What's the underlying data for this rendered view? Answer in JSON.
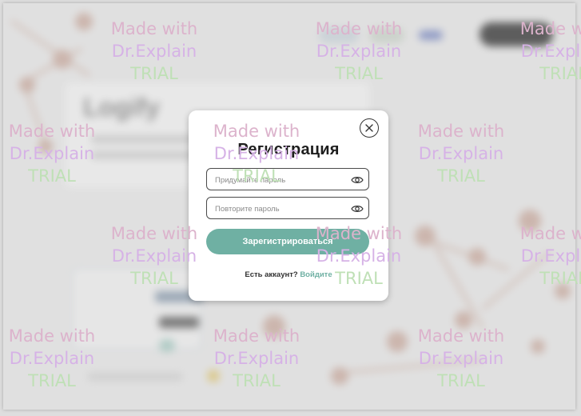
{
  "modal": {
    "title": "Регистрация",
    "password_placeholder": "Придумайте пароль",
    "repeat_password_placeholder": "Повторите пароль",
    "submit_label": "Зарегистрироваться",
    "footer_text": "Есть аккаунт?",
    "login_link": "Войдите",
    "accent_color": "#6fb0a3",
    "close_icon": "close-icon",
    "eye_icon": "eye-icon"
  },
  "background": {
    "logo_text": "Logify"
  },
  "watermark": {
    "line1": "Made with",
    "line2": "Dr.Explain",
    "line3": "TRIAL"
  }
}
